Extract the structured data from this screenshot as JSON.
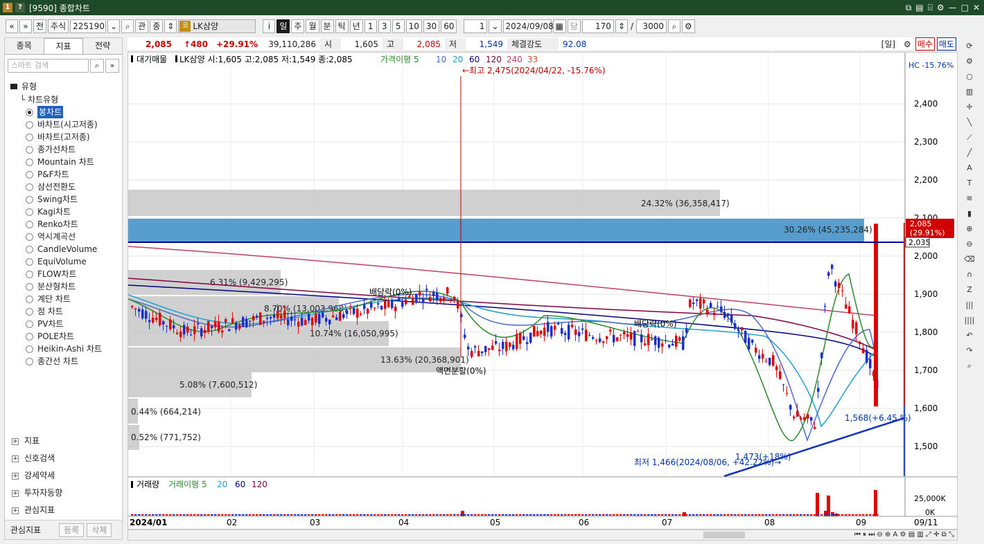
{
  "window": {
    "title": "[9590] 종합차트"
  },
  "toolbar": {
    "nav_back": "«",
    "nav_down": "»",
    "prev_label": "전",
    "market_label": "주식",
    "code": "225190",
    "group_label": "관",
    "jump_label": "종",
    "stock_badge": "코",
    "stock_name": "LK삼양",
    "info_label": "i",
    "periods": [
      "일",
      "주",
      "월",
      "분",
      "틱",
      "년"
    ],
    "period_selected": "일",
    "intervals": [
      "1",
      "3",
      "5",
      "10",
      "30",
      "60"
    ],
    "unit_value": "1",
    "date": "2024/09/08",
    "count_label": "당",
    "count": "170",
    "total": "3000"
  },
  "tabs": {
    "items": [
      "종목",
      "지표",
      "전략"
    ],
    "active": "지표"
  },
  "search": {
    "placeholder": "스마트 검색"
  },
  "tree": {
    "group_type": "유형",
    "sub_chart_type": "차트유형",
    "types": [
      "봉차트",
      "바차트(시고저종)",
      "바차트(고저종)",
      "종가선차트",
      "Mountain 차트",
      "P&F차트",
      "삼선전환도",
      "Swing차트",
      "Kagi차트",
      "Renko차트",
      "역시계곡선",
      "CandleVolume",
      "EquiVolume",
      "FLOW차트",
      "분산형차트",
      "계단 차트",
      "점 차트",
      "PV차트",
      "POLE차트",
      "Heikin-Ashi 차트",
      "종간선 차트"
    ],
    "selected": "봉차트",
    "groups": [
      "지표",
      "신호검색",
      "강세약세",
      "투자자동향",
      "관심지표"
    ]
  },
  "leftfoot": {
    "label": "관심지표",
    "register": "등록",
    "delete": "삭제"
  },
  "info": {
    "price": "2,085",
    "change": "↑480",
    "change_pct": "+29.91%",
    "volume": "39,110,286",
    "open_label": "시",
    "open": "1,605",
    "high_label": "고",
    "high": "2,085",
    "low_label": "저",
    "low": "1,549",
    "strength_label": "체결강도",
    "strength": "92.08",
    "period_tag": "[일]",
    "buy": "매수",
    "sell": "매도"
  },
  "legend": {
    "main": "대기매물",
    "stock": "LK삼양 시:1,605 고:2,085 저:1,549 종:2,085",
    "ma_label": "가격이평 5",
    "ma": [
      "10",
      "20",
      "60",
      "120",
      "240",
      "33"
    ],
    "ma_colors": [
      "#2a8a2a",
      "#4a6ad0",
      "#20a0d0",
      "#000080",
      "#800040",
      "#c04060",
      "#d05030"
    ],
    "hc": "HC -15.76%"
  },
  "annotations": {
    "high": "←최고 2,475(2024/04/22, -15.76%)",
    "low": "최저 1,466(2024/08/06, +42.22%)→",
    "div1": "배당락(0%)",
    "div2": "배당락(0%)",
    "split": "액면분할(0%)",
    "pt1473": "1,473(+18%)",
    "pt1568": "1,568(+6.45 %)"
  },
  "profile": [
    {
      "label": "24.32% (36,358,417)"
    },
    {
      "label": "30.26% (45,235,284)"
    },
    {
      "label": "6.31% (9,429,295)"
    },
    {
      "label": "8.70% (13,003,963)"
    },
    {
      "label": "10.74% (16,050,995)"
    },
    {
      "label": "13.63% (20,368,901)"
    },
    {
      "label": "5.08% (7,600,512)"
    },
    {
      "label": "0.44% (664,214)"
    },
    {
      "label": "0.52% (771,752)"
    }
  ],
  "price_axis": [
    "2,400",
    "2,300",
    "2,200",
    "2,100",
    "2,000",
    "1,900",
    "1,800",
    "1,700",
    "1,600",
    "1,500"
  ],
  "price_tags": {
    "current": "2,085",
    "current_pct": "(29.91%)",
    "line": "2,035"
  },
  "volume": {
    "legend": "거래량",
    "ma_label": "거래이평 5",
    "ma": [
      "20",
      "60",
      "120"
    ],
    "axis": [
      "25,000K",
      "0K"
    ]
  },
  "time_axis": {
    "start": "2024/01",
    "months": [
      "02",
      "03",
      "04",
      "05",
      "06",
      "07",
      "08",
      "09"
    ],
    "end": "09/11"
  },
  "chart_data": {
    "type": "candlestick",
    "note_series": "daily OHLC, 2024/01 – 2024/09",
    "highlight": {
      "last_close": 2085,
      "high": 2475,
      "low": 1466
    },
    "support_line": {
      "from": 1466,
      "to": 1568
    },
    "resistance_line": 2035
  }
}
